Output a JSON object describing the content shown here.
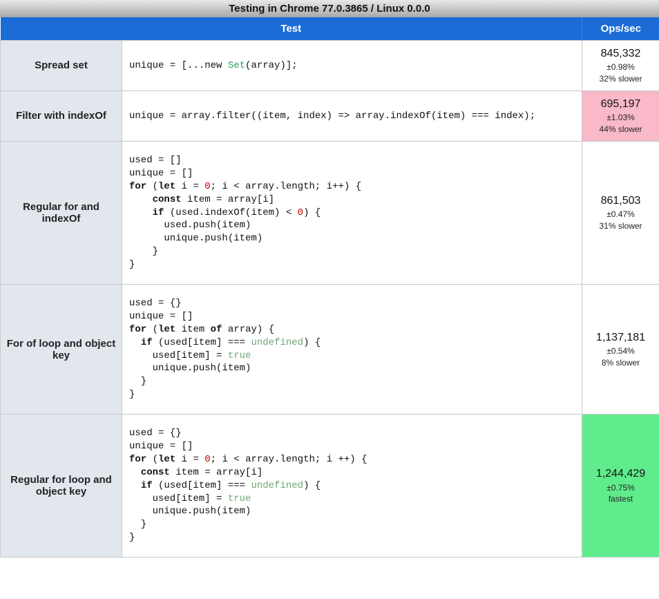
{
  "title": "Testing in Chrome 77.0.3865 / Linux 0.0.0",
  "headers": {
    "test": "Test",
    "ops": "Ops/sec"
  },
  "rows": [
    {
      "name": "Spread set",
      "ops": "845,332",
      "err": "±0.98%",
      "slower": "32% slower",
      "ops_class": ""
    },
    {
      "name": "Filter with indexOf",
      "ops": "695,197",
      "err": "±1.03%",
      "slower": "44% slower",
      "ops_class": "ops-slowest"
    },
    {
      "name": "Regular for and indexOf",
      "ops": "861,503",
      "err": "±0.47%",
      "slower": "31% slower",
      "ops_class": ""
    },
    {
      "name": "For of loop and object key",
      "ops": "1,137,181",
      "err": "±0.54%",
      "slower": "8% slower",
      "ops_class": ""
    },
    {
      "name": "Regular for loop and object key",
      "ops": "1,244,429",
      "err": "±0.75%",
      "slower": "fastest",
      "ops_class": "ops-fastest"
    }
  ],
  "code": {
    "r0": "unique = [...new Set(array)];",
    "r1": "unique = array.filter((item, index) => array.indexOf(item) === index);",
    "r2_l0": "used = []",
    "r2_l1": "unique = []",
    "r2_l2a": "for",
    "r2_l2b": " (",
    "r2_l2c": "let",
    "r2_l2d": " i = ",
    "r2_l2e": "0",
    "r2_l2f": "; i < array.length; i++) {",
    "r2_l3a": "    ",
    "r2_l3b": "const",
    "r2_l3c": " item = array[i]",
    "r2_l4a": "    ",
    "r2_l4b": "if",
    "r2_l4c": " (used.indexOf(item) < ",
    "r2_l4d": "0",
    "r2_l4e": ") {",
    "r2_l5": "      used.push(item)",
    "r2_l6": "      unique.push(item)",
    "r2_l7": "    }",
    "r2_l8": "}",
    "r3_l0": "used = {}",
    "r3_l1": "unique = []",
    "r3_l2a": "for",
    "r3_l2b": " (",
    "r3_l2c": "let",
    "r3_l2d": " item ",
    "r3_l2e": "of",
    "r3_l2f": " array) {",
    "r3_l3a": "  ",
    "r3_l3b": "if",
    "r3_l3c": " (used[item] === ",
    "r3_l3d": "undefined",
    "r3_l3e": ") {",
    "r3_l4a": "    used[item] = ",
    "r3_l4b": "true",
    "r3_l5": "    unique.push(item)",
    "r3_l6": "  }",
    "r3_l7": "}",
    "r4_l0": "used = {}",
    "r4_l1": "unique = []",
    "r4_l2a": "for",
    "r4_l2b": " (",
    "r4_l2c": "let",
    "r4_l2d": " i = ",
    "r4_l2e": "0",
    "r4_l2f": "; i < array.length; i ++) {",
    "r4_l3a": "  ",
    "r4_l3b": "const",
    "r4_l3c": " item = array[i]",
    "r4_l4a": "  ",
    "r4_l4b": "if",
    "r4_l4c": " (used[item] === ",
    "r4_l4d": "undefined",
    "r4_l4e": ") {",
    "r4_l5a": "    used[item] = ",
    "r4_l5b": "true",
    "r4_l6": "    unique.push(item)",
    "r4_l7": "  }",
    "r4_l8": "}"
  }
}
